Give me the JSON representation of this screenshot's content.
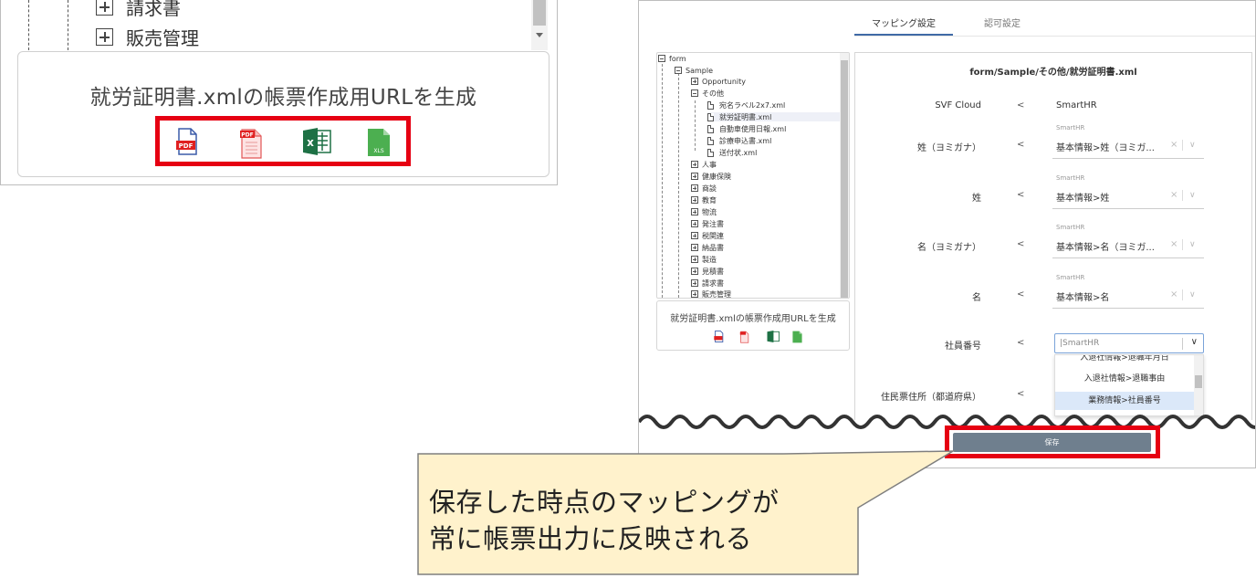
{
  "zoom": {
    "tree_items": [
      "請求書",
      "販売管理"
    ],
    "generate_label": "就労証明書.xmlの帳票作成用URLを生成"
  },
  "app": {
    "tabs": [
      "マッピング設定",
      "認可設定"
    ],
    "tree": {
      "root": "form",
      "sample": "Sample",
      "opportunity": "Opportunity",
      "other": "その他",
      "files": [
        "宛名ラベル2x7.xml",
        "就労証明書.xml",
        "自動車使用日報.xml",
        "診療申込書.xml",
        "送付状.xml"
      ],
      "folders": [
        "人事",
        "健康保険",
        "商談",
        "教育",
        "物流",
        "発注書",
        "税関連",
        "納品書",
        "製造",
        "見積書",
        "請求書",
        "販売管理"
      ]
    },
    "generate_label": "就労証明書.xmlの帳票作成用URLを生成",
    "mapping": {
      "title": "form/Sample/その他/就労証明書.xml",
      "header": {
        "left": "SVF Cloud",
        "arrow": "<",
        "right": "SmartHR"
      },
      "rows": [
        {
          "label": "姓（ヨミガナ）",
          "arrow": "<",
          "source": "SmartHR",
          "value": "基本情報>姓（ヨミガ...",
          "clear": "×",
          "chevron": "∨"
        },
        {
          "label": "姓",
          "arrow": "<",
          "source": "SmartHR",
          "value": "基本情報>姓",
          "clear": "×",
          "chevron": "∨"
        },
        {
          "label": "名（ヨミガナ）",
          "arrow": "<",
          "source": "SmartHR",
          "value": "基本情報>名（ヨミガ...",
          "clear": "×",
          "chevron": "∨"
        },
        {
          "label": "名",
          "arrow": "<",
          "source": "SmartHR",
          "value": "基本情報>名",
          "clear": "×",
          "chevron": "∨"
        }
      ],
      "employee": {
        "label": "社員番号",
        "arrow": "<",
        "value": "|SmartHR",
        "chevron": "∨"
      },
      "dropdown_options": [
        "入退社情報>退職年月日",
        "入退社情報>退職事由",
        "業務情報>社員番号"
      ],
      "address": {
        "label": "住民票住所（都道府県）",
        "arrow": "<"
      }
    },
    "save_label": "保存"
  },
  "callout": {
    "line1": "保存した時点のマッピングが",
    "line2": "常に帳票出力に反映される"
  },
  "colors": {
    "highlight": "#e60012",
    "callout_fill": "#fff2cc",
    "save_button": "#6f7f8e"
  }
}
